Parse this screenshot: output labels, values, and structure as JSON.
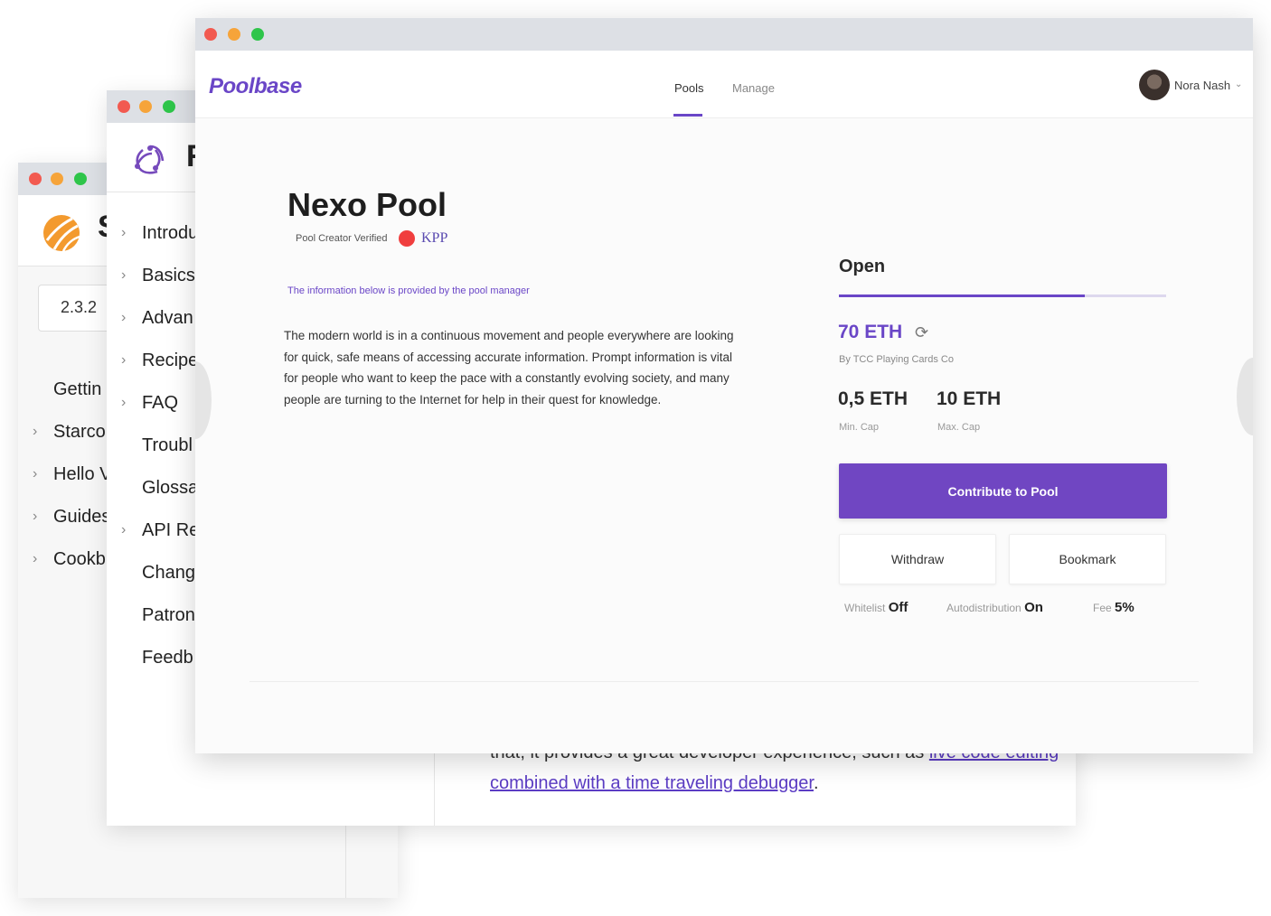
{
  "win1": {
    "brand": "S",
    "version": "2.3.2",
    "nav": [
      {
        "label": "Gettin",
        "chevron": false
      },
      {
        "label": "Starco",
        "chevron": true
      },
      {
        "label": "Hello V",
        "chevron": true
      },
      {
        "label": "Guides",
        "chevron": true
      },
      {
        "label": "Cookb",
        "chevron": true
      }
    ]
  },
  "win2": {
    "brand": "R",
    "nav": [
      {
        "label": "Introdu",
        "chevron": true
      },
      {
        "label": "Basics",
        "chevron": true
      },
      {
        "label": "Advan",
        "chevron": true
      },
      {
        "label": "Recipe",
        "chevron": true
      },
      {
        "label": "FAQ",
        "chevron": true
      },
      {
        "label": "Troubl",
        "chevron": false
      },
      {
        "label": "Glossa",
        "chevron": false
      },
      {
        "label": "API Re",
        "chevron": true
      },
      {
        "label": "Chang",
        "chevron": false
      },
      {
        "label": "Patron",
        "chevron": false
      },
      {
        "label": "Feedb",
        "chevron": false
      }
    ],
    "content": {
      "line1": "that, it provides a great developer experience, such as ",
      "link1": "live code editing",
      "link2": "combined with a time traveling debugger",
      "end": "."
    }
  },
  "app": {
    "logo": "Poolbase",
    "tabs": [
      {
        "label": "Pools",
        "active": true
      },
      {
        "label": "Manage",
        "active": false
      }
    ],
    "user": {
      "name": "Nora Nash"
    },
    "pool": {
      "title": "Nexo Pool",
      "verified_label": "Pool Creator Verified",
      "creator_mark": "KPP",
      "info_note": "The information below is provided by the pool manager",
      "description": "The modern world is in a continuous movement and people everywhere are looking for quick, safe means of accessing accurate information. Prompt information is vital for people who want to keep the pace with a constantly evolving society, and many people are turning to the Internet for help in their quest for knowledge.",
      "status": "Open",
      "progress": 0.75,
      "amount": "70 ETH",
      "by": "By TCC Playing Cards Co",
      "min_cap": {
        "value": "0,5 ETH",
        "label": "Min. Cap"
      },
      "max_cap": {
        "value": "10 ETH",
        "label": "Max. Cap"
      },
      "contribute_label": "Contribute to Pool",
      "withdraw_label": "Withdraw",
      "bookmark_label": "Bookmark",
      "whitelist": {
        "label": "Whitelist",
        "value": "Off"
      },
      "autodistribution": {
        "label": "Autodistribution",
        "value": "On"
      },
      "fee": {
        "label": "Fee",
        "value": "5%"
      }
    }
  },
  "colors": {
    "accent": "#6a46c7",
    "button": "#7046c2",
    "kpp_dot": "#f03e3e"
  },
  "icons": {
    "refresh": "refresh-icon",
    "chevron": "chevron-right-icon",
    "user_caret": "chevron-down-icon"
  }
}
